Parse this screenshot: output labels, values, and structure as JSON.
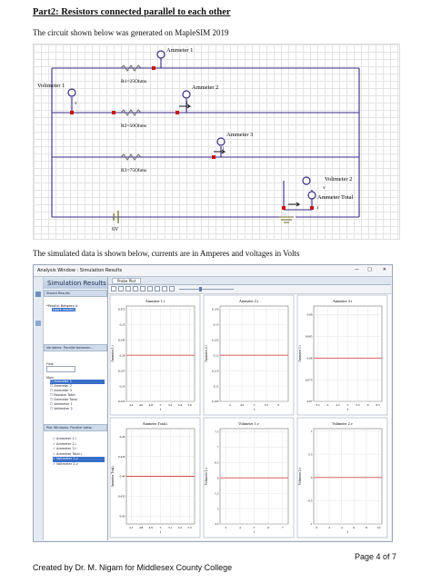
{
  "heading": "Part2:  Resistors connected parallel to each other",
  "intro": "The circuit shown below was generated on MapleSIM 2019",
  "circuit": {
    "ammeter1": "Ammeter 1",
    "ammeter2": "Ammeter 2",
    "ammeter3": "Ammeter 3",
    "ammeter_total": "Ammeter Total",
    "voltmeter1": "Voltmeter 1",
    "voltmeter2": "Voltmeter 2",
    "r1": "R1=25Ohms",
    "r2": "R2=50Ohms",
    "r3": "R3=75Ohms",
    "source": "6V",
    "v_symbol": "v",
    "i_symbol": "i"
  },
  "sim_caption": "The simulated data is shown below, currents are in Amperes and voltages in Volts",
  "sim_window": {
    "title": "Analysis Window : Simulation Results",
    "window_controls": [
      "—",
      "□",
      "✕"
    ],
    "header": "Simulation Results",
    "stored_results_label": "Stored Results",
    "stored_item": "*Parallel Between A",
    "stored_subitem": "(work results)",
    "variables_label": "Variables: Parallel between...",
    "find_label": "Find:",
    "variables_group": "Main",
    "variables": [
      "Ammeter 1",
      "Ammeter 2",
      "Ammeter 3",
      "Resistor Total",
      "Ammeter Total",
      "Voltmeter 1",
      "Voltmeter 2"
    ],
    "plot_windows_label": "Plot Windows: Parallel betw...",
    "plot_items": [
      "Ammeter 1.i",
      "Ammeter 2.i",
      "Ammeter 3.i",
      "Ammeter Total.i",
      "Voltmeter 1.v",
      "Voltmeter 2.v"
    ],
    "plot_tab": "Probe Plot",
    "xlabel": "t"
  },
  "chart_data": [
    {
      "type": "line",
      "title": "Ammeter 1.i",
      "ylabel": "Ammeter 1.i",
      "xlabel": "t",
      "xticks": [
        4.4,
        4.6,
        4.8,
        5.0,
        5.2,
        5.4,
        5.6
      ],
      "yticks": [
        0.225,
        0.23,
        0.235,
        0.24,
        0.245,
        0.25,
        0.255
      ],
      "xlim": [
        4.3,
        5.7
      ],
      "ylim": [
        0.225,
        0.256
      ],
      "series": [
        {
          "x": [
            4.3,
            5.7
          ],
          "y": [
            0.24,
            0.24
          ]
        }
      ]
    },
    {
      "type": "line",
      "title": "Ammeter 2.i",
      "ylabel": "Ammeter 2.i",
      "xlabel": "t",
      "xticks": [
        4,
        4.5,
        5,
        5.5,
        6
      ],
      "yticks": [
        0.105,
        0.11,
        0.115,
        0.12,
        0.125,
        0.13,
        0.135
      ],
      "xlim": [
        3.6,
        6.4
      ],
      "ylim": [
        0.105,
        0.136
      ],
      "series": [
        {
          "x": [
            3.6,
            6.4
          ],
          "y": [
            0.12,
            0.12
          ]
        }
      ]
    },
    {
      "type": "line",
      "title": "Ammeter 3.i",
      "ylabel": "Ammeter 3.i",
      "xlabel": "t",
      "xticks": [
        3.5,
        4,
        4.5,
        5,
        5.5,
        6,
        6.5
      ],
      "yticks": [
        0.07,
        0.075,
        0.08,
        0.085,
        0.09
      ],
      "xlim": [
        3.3,
        6.7
      ],
      "ylim": [
        0.07,
        0.092
      ],
      "series": [
        {
          "x": [
            3.3,
            6.7
          ],
          "y": [
            0.08,
            0.08
          ]
        }
      ]
    },
    {
      "type": "line",
      "title": "Ammeter Total.i",
      "ylabel": "Ammeter Total.i",
      "xlabel": "t",
      "xticks": [
        4.7,
        4.8,
        4.9,
        5.0,
        5.1,
        5.2,
        5.3
      ],
      "yticks": [
        0.43,
        0.435,
        0.44,
        0.445,
        0.45
      ],
      "xlim": [
        4.65,
        5.35
      ],
      "ylim": [
        0.428,
        0.452
      ],
      "series": [
        {
          "x": [
            4.65,
            5.35
          ],
          "y": [
            0.44,
            0.44
          ]
        }
      ]
    },
    {
      "type": "line",
      "title": "Voltmeter 1.v",
      "ylabel": "Voltmeter 1.v",
      "xlabel": "t",
      "xticks": [
        3,
        4,
        5,
        6,
        7
      ],
      "yticks": [
        4.5,
        5,
        5.5,
        6,
        6.5,
        7,
        7.5
      ],
      "xlim": [
        2.6,
        7.4
      ],
      "ylim": [
        4.5,
        7.6
      ],
      "series": [
        {
          "x": [
            2.6,
            7.4
          ],
          "y": [
            6,
            6
          ]
        }
      ]
    },
    {
      "type": "line",
      "title": "Voltmeter 2.v",
      "ylabel": "Voltmeter 2.v",
      "xlabel": "t",
      "xticks": [
        0,
        2,
        4,
        6,
        8,
        10
      ],
      "yticks": [
        -1,
        -0.5,
        0,
        0.5,
        1
      ],
      "xlim": [
        -0.5,
        10.5
      ],
      "ylim": [
        -1,
        1.05
      ],
      "series": [
        {
          "x": [
            -0.5,
            10.5
          ],
          "y": [
            0,
            0
          ]
        }
      ]
    }
  ],
  "page_number": "Page 4 of 7",
  "footer": "Created by Dr. M. Nigam for Middlesex County College",
  "colors": {
    "wire": "#3a2a8a",
    "resistor": "#6a6a6a",
    "meter": "#3a2a8a",
    "node": "#cc1111",
    "trace": "#d64b4b",
    "ground": "#6a6a20"
  }
}
